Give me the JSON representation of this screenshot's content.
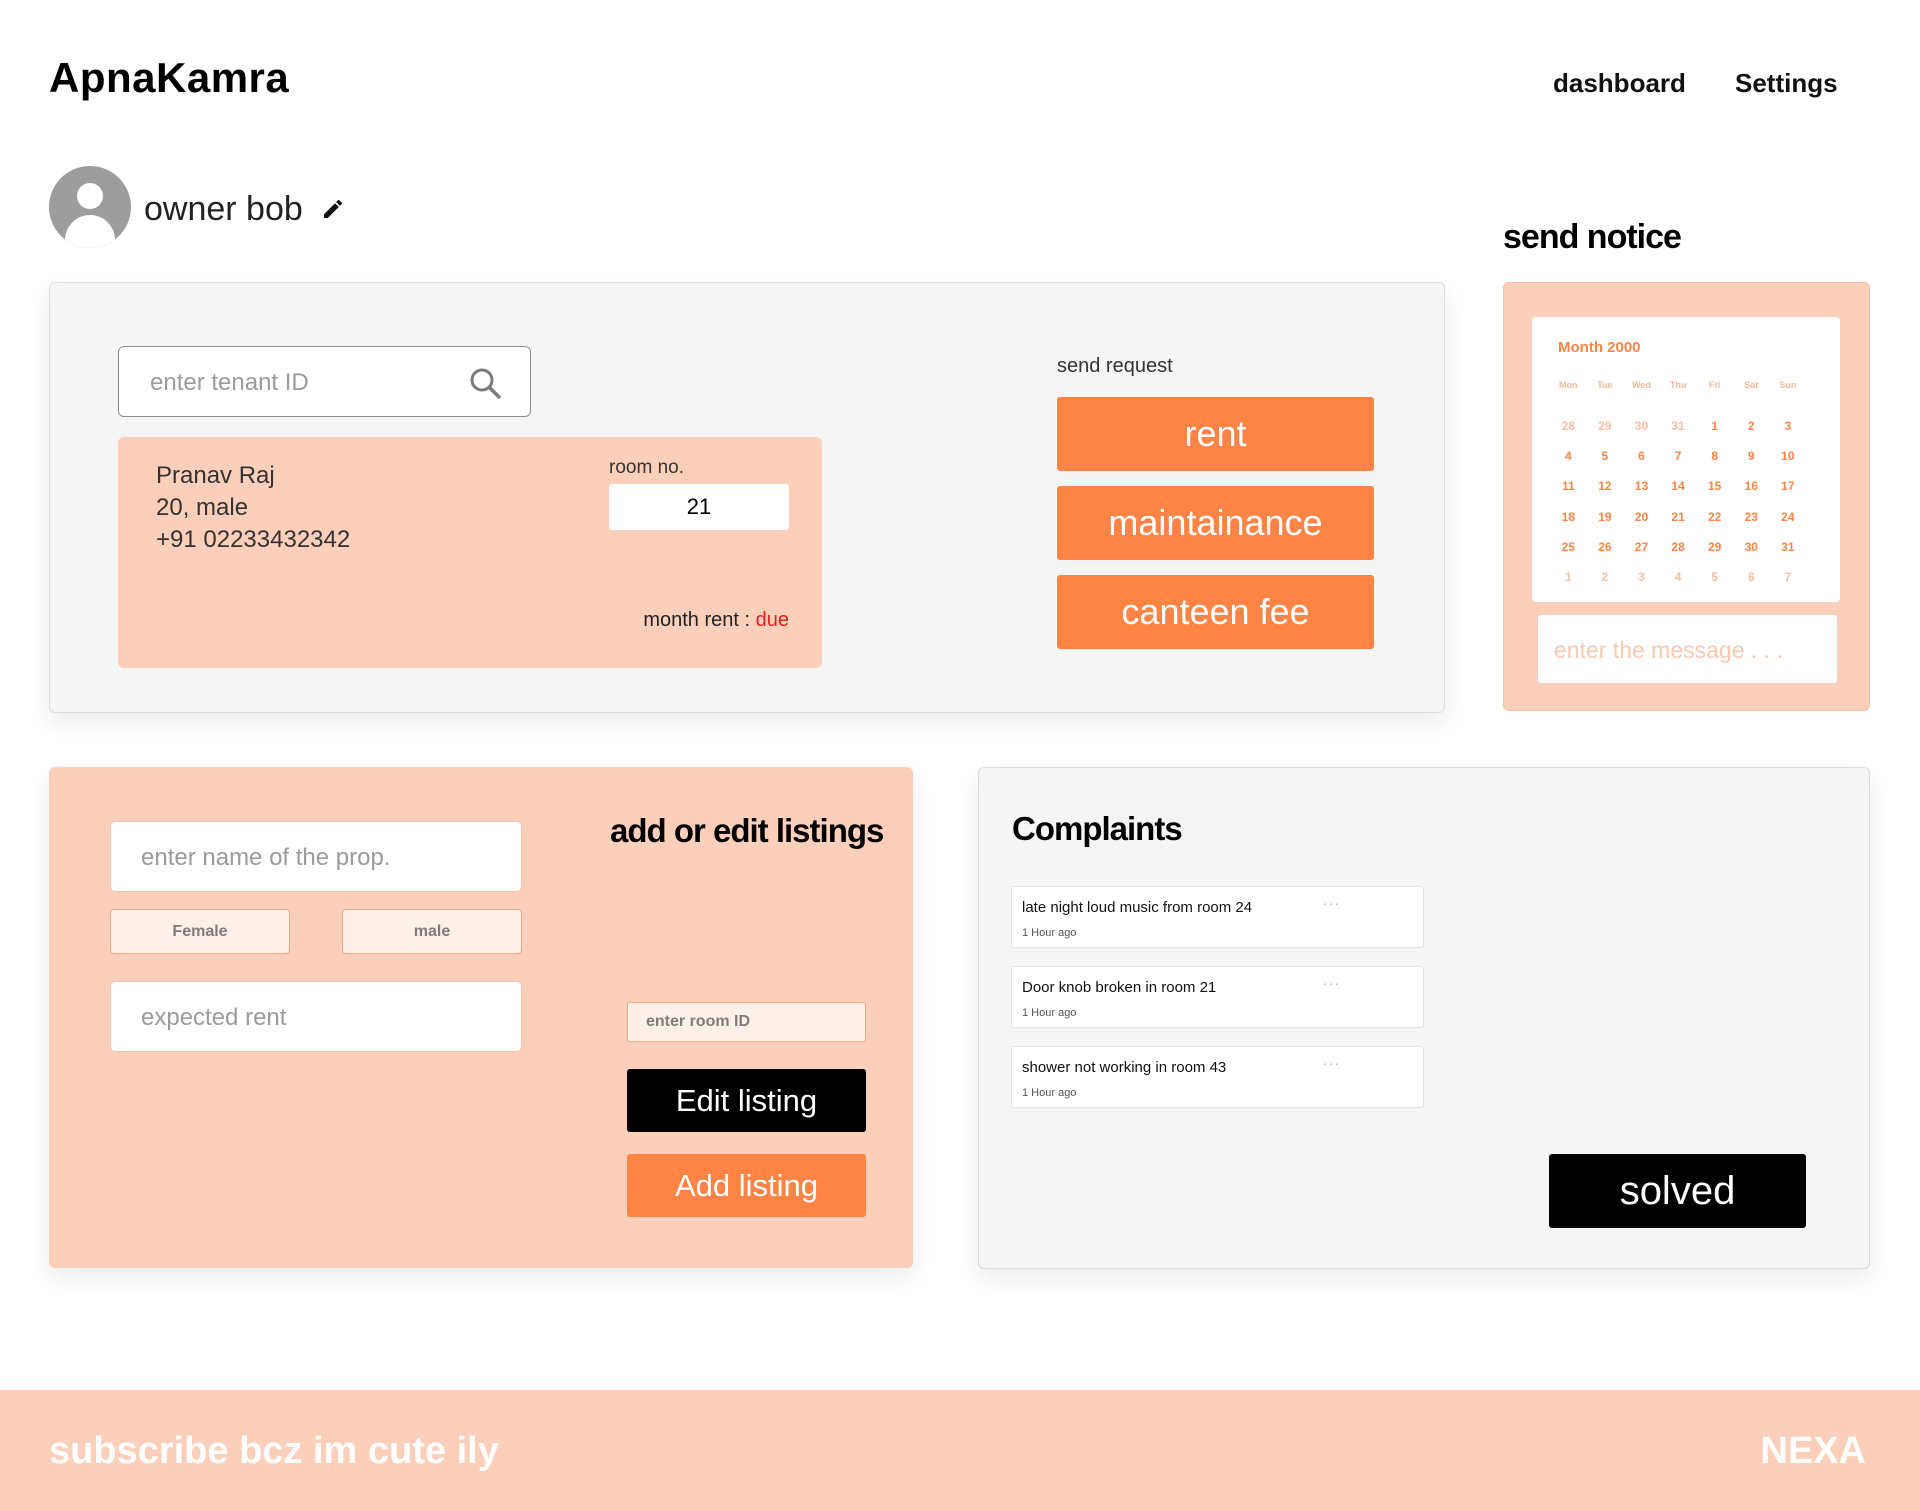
{
  "header": {
    "logo": "ApnaKamra",
    "nav": [
      "dashboard",
      "Settings"
    ]
  },
  "profile": {
    "name": "owner bob",
    "avatar_icon": "user-avatar-icon",
    "edit_icon": "pencil-icon"
  },
  "tenant": {
    "search_placeholder": "enter tenant ID",
    "search_icon": "search-icon",
    "name": "Pranav Raj",
    "details": "20, male",
    "phone": "+91 02233432342",
    "room_label": "room no.",
    "room_number": "21",
    "rent_label": "month rent : ",
    "rent_status": "due"
  },
  "request": {
    "label": "send request",
    "buttons": [
      "rent",
      "maintainance",
      "canteen fee"
    ]
  },
  "notice": {
    "title": "send notice",
    "calendar_month": "Month 2000",
    "weekdays": [
      "Mon",
      "Tue",
      "Wed",
      "Thu",
      "Fri",
      "Sat",
      "Sun"
    ],
    "days": [
      {
        "d": "28",
        "m": true
      },
      {
        "d": "29",
        "m": true
      },
      {
        "d": "30",
        "m": true
      },
      {
        "d": "31",
        "m": true
      },
      {
        "d": "1"
      },
      {
        "d": "2"
      },
      {
        "d": "3"
      },
      {
        "d": "4"
      },
      {
        "d": "5"
      },
      {
        "d": "6"
      },
      {
        "d": "7"
      },
      {
        "d": "8"
      },
      {
        "d": "9"
      },
      {
        "d": "10"
      },
      {
        "d": "11"
      },
      {
        "d": "12"
      },
      {
        "d": "13"
      },
      {
        "d": "14"
      },
      {
        "d": "15"
      },
      {
        "d": "16"
      },
      {
        "d": "17"
      },
      {
        "d": "18"
      },
      {
        "d": "19"
      },
      {
        "d": "20"
      },
      {
        "d": "21"
      },
      {
        "d": "22"
      },
      {
        "d": "23"
      },
      {
        "d": "24"
      },
      {
        "d": "25"
      },
      {
        "d": "26"
      },
      {
        "d": "27"
      },
      {
        "d": "28"
      },
      {
        "d": "29"
      },
      {
        "d": "30"
      },
      {
        "d": "31"
      },
      {
        "d": "1",
        "m": true
      },
      {
        "d": "2",
        "m": true
      },
      {
        "d": "3",
        "m": true
      },
      {
        "d": "4",
        "m": true
      },
      {
        "d": "5",
        "m": true
      },
      {
        "d": "6",
        "m": true
      },
      {
        "d": "7",
        "m": true
      }
    ],
    "message_placeholder": "enter the message . . ."
  },
  "listing": {
    "title": "add or edit listings",
    "name_placeholder": "enter name of the prop.",
    "gender_options": [
      "Female",
      "male"
    ],
    "rent_placeholder": "expected rent",
    "room_id_placeholder": "enter room ID",
    "edit_label": "Edit listing",
    "add_label": "Add listing"
  },
  "complaints": {
    "title": "Complaints",
    "items": [
      {
        "text": "late night loud music from room 24",
        "time": "1 Hour ago"
      },
      {
        "text": "Door knob broken in room 21",
        "time": "1 Hour ago"
      },
      {
        "text": "shower not working in room 43",
        "time": "1 Hour ago"
      }
    ],
    "more_icon": "more-dots-icon",
    "solved_label": "solved"
  },
  "footer": {
    "left": "subscribe bcz im cute ily",
    "right": "NEXA"
  },
  "colors": {
    "accent": "#fd8444",
    "panel_peach": "#fbcfb9",
    "due_red": "#e0201a"
  }
}
